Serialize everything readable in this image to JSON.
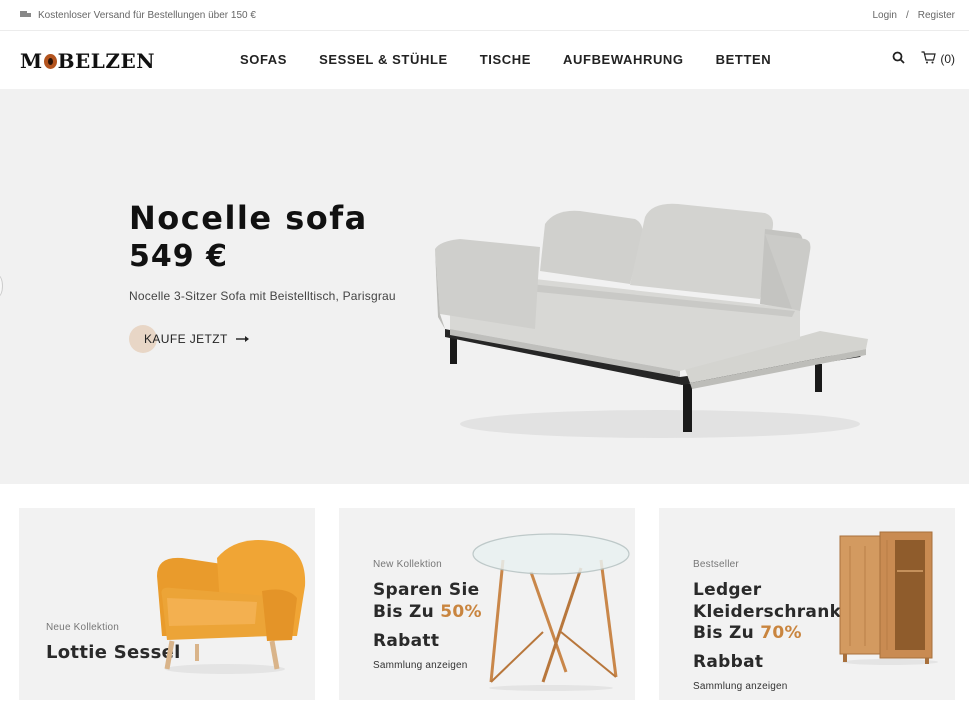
{
  "topbar": {
    "shipping_icon": "truck-icon",
    "shipping_text": "Kostenloser Versand für Bestellungen über 150 €",
    "login": "Login",
    "separator": "/",
    "register": "Register"
  },
  "header": {
    "logo": {
      "pre": "M",
      "post": "BELZEN"
    },
    "nav": [
      "SOFAS",
      "SESSEL & STÜHLE",
      "TISCHE",
      "AUFBEWAHRUNG",
      "BETTEN"
    ],
    "search_icon": "search-icon",
    "cart_icon": "cart-icon",
    "cart_count": "(0)"
  },
  "hero": {
    "title": "Nocelle sofa",
    "price": "549 €",
    "description": "Nocelle 3-Sitzer Sofa mit Beistelltisch, Parisgrau",
    "cta": "KAUFE JETZT",
    "cta_icon": "arrow-right-icon"
  },
  "banners": [
    {
      "tag": "Neue Kollektion",
      "title": "Lottie Sessel"
    },
    {
      "tag": "New Kollektion",
      "line1": "Sparen Sie",
      "line2_pre": "Bis Zu ",
      "line2_accent": "50%",
      "line3": "Rabatt",
      "link": "Sammlung anzeigen"
    },
    {
      "tag": "Bestseller",
      "line1": "Ledger",
      "line2": "Kleiderschrank",
      "line3_pre": "Bis Zu ",
      "line3_accent": "70%",
      "line4": "Rabbat",
      "link": "Sammlung anzeigen"
    }
  ],
  "colors": {
    "accent": "#c9853f",
    "hero_bg": "#f1f1f1",
    "banner_bg": "#f2f2f2",
    "logo_accent": "#b3541e"
  }
}
